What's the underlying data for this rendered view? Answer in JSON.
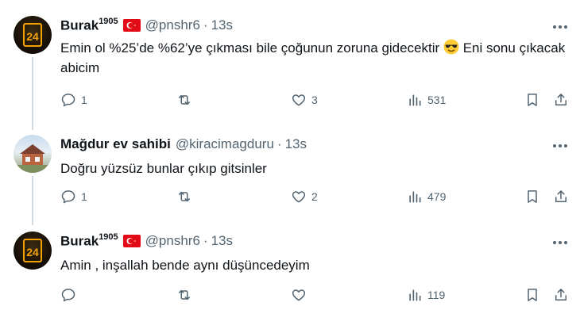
{
  "tweets": [
    {
      "name": "Burak",
      "name_sup": "1905",
      "handle": "@pnshr6",
      "separator": "·",
      "time": "13s",
      "text_part1": "Emin ol %25’de %62’ye çıkması bile çoğunun zoruna gidecektir",
      "text_part2": "Eni sonu çıkacak abicim",
      "emoji": "smiling-face-with-sunglasses",
      "avatar_text": "24",
      "replies": "1",
      "retweets": "",
      "likes": "3",
      "views": "531"
    },
    {
      "name": "Mağdur ev sahibi",
      "handle": "@kiracimagduru",
      "separator": "·",
      "time": "13s",
      "text": "Doğru yüzsüz bunlar çıkıp gitsinler",
      "replies": "1",
      "retweets": "",
      "likes": "2",
      "views": "479"
    },
    {
      "name": "Burak",
      "name_sup": "1905",
      "handle": "@pnshr6",
      "separator": "·",
      "time": "13s",
      "text": "Amin , inşallah bende aynı düşüncedeyim",
      "avatar_text": "24",
      "replies": "",
      "retweets": "",
      "likes": "",
      "views": "119"
    }
  ],
  "colors": {
    "text_primary": "#0f1419",
    "text_secondary": "#536471",
    "thread_line": "#cfd9de",
    "avatar_accent": "#f2a100",
    "flag_red": "#e30a17"
  }
}
